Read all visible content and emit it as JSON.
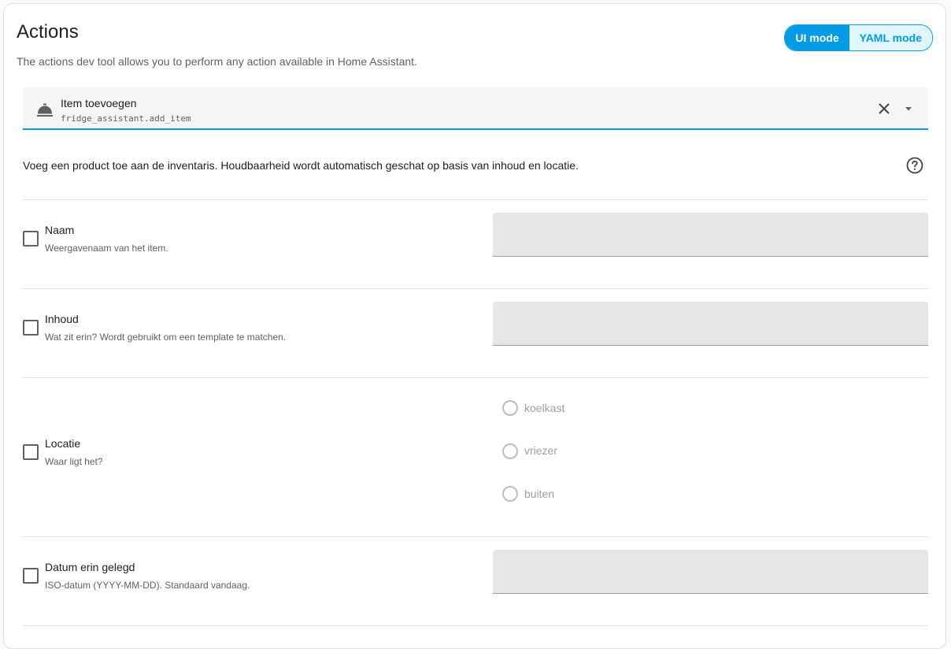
{
  "header": {
    "title": "Actions",
    "subtitle": "The actions dev tool allows you to perform any action available in Home Assistant.",
    "modes": [
      {
        "label": "UI mode",
        "active": true
      },
      {
        "label": "YAML mode",
        "active": false
      }
    ]
  },
  "action": {
    "name": "Item toevoegen",
    "id": "fridge_assistant.add_item",
    "icon": "room-service-icon"
  },
  "description": "Voeg een product toe aan de inventaris. Houdbaarheid wordt automatisch geschat op basis van inhoud en locatie.",
  "fields": {
    "naam": {
      "label": "Naam",
      "help": "Weergavenaam van het item.",
      "value": "",
      "enabled": false
    },
    "inhoud": {
      "label": "Inhoud",
      "help": "Wat zit erin? Wordt gebruikt om een template te matchen.",
      "value": "",
      "enabled": false
    },
    "locatie": {
      "label": "Locatie",
      "help": "Waar ligt het?",
      "enabled": false,
      "options": [
        "koelkast",
        "vriezer",
        "buiten"
      ]
    },
    "datum": {
      "label": "Datum erin gelegd",
      "help": "ISO-datum (YYYY-MM-DD). Standaard vandaag.",
      "value": "",
      "enabled": false
    }
  },
  "colors": {
    "accent": "#039be5",
    "accent_light": "#e1f5fe",
    "input_bg": "#e6e6e6"
  }
}
